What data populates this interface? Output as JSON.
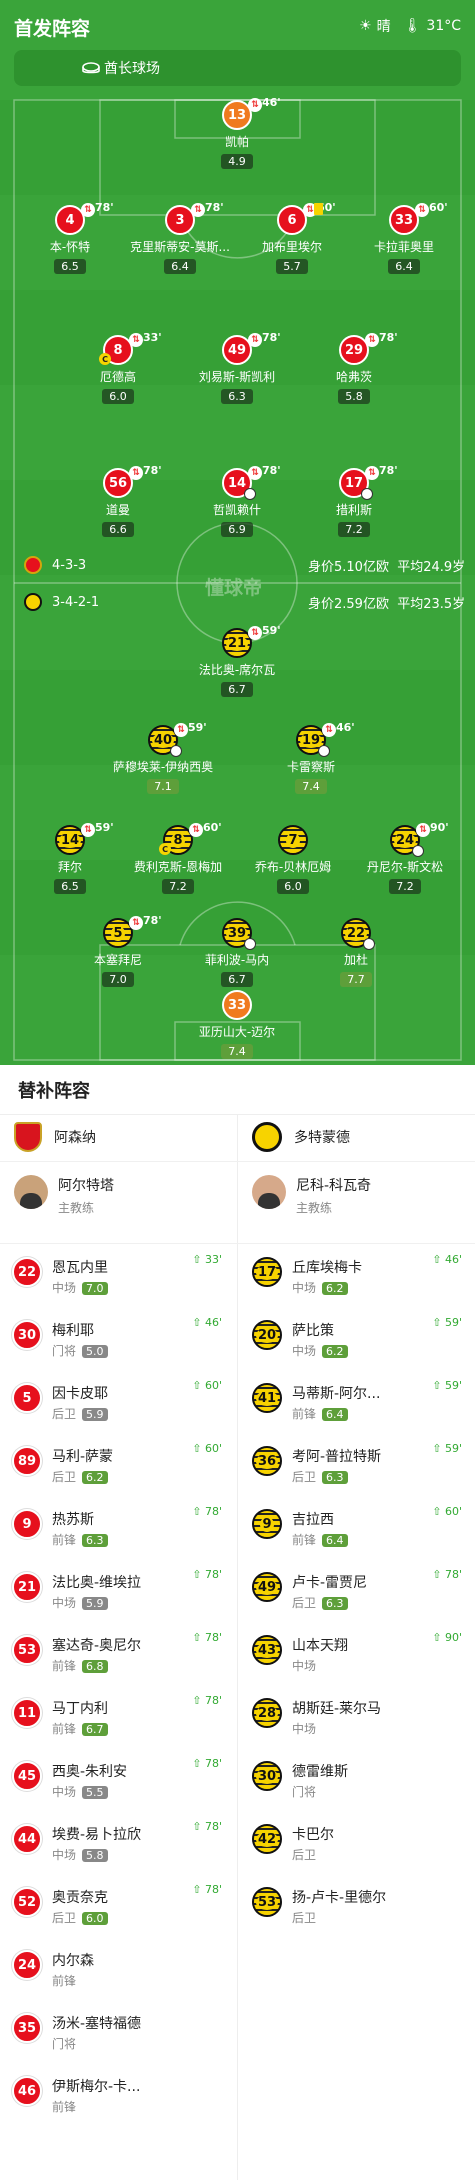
{
  "header": {
    "title": "首发阵容",
    "weather": "晴",
    "temp": "31°C",
    "venue": "酋长球场"
  },
  "watermark": "懂球帝",
  "arsenal": {
    "formation": "4-3-3",
    "value": "身价5.10亿欧",
    "age": "平均24.9岁"
  },
  "dortmund": {
    "formation": "3-4-2-1",
    "value": "身价2.59亿欧",
    "age": "平均23.5岁"
  },
  "starters": [
    {
      "num": "13",
      "name": "凯帕",
      "rate": "4.9",
      "sub": "46'",
      "kit": "gk"
    },
    {
      "num": "4",
      "name": "本-怀特",
      "rate": "6.5",
      "sub": "78'",
      "kit": "red"
    },
    {
      "num": "3",
      "name": "克里斯蒂安-莫斯...",
      "rate": "6.4",
      "sub": "78'",
      "kit": "red"
    },
    {
      "num": "6",
      "name": "加布里埃尔",
      "rate": "5.7",
      "sub": "60'",
      "kit": "red"
    },
    {
      "num": "33",
      "name": "卡拉菲奥里",
      "rate": "6.4",
      "sub": "60'",
      "kit": "red"
    },
    {
      "num": "8",
      "name": "厄德高",
      "rate": "6.0",
      "sub": "33'",
      "kit": "red"
    },
    {
      "num": "49",
      "name": "刘易斯-斯凯利",
      "rate": "6.3",
      "sub": "78'",
      "kit": "red"
    },
    {
      "num": "29",
      "name": "哈弗茨",
      "rate": "5.8",
      "sub": "78'",
      "kit": "red"
    },
    {
      "num": "56",
      "name": "道曼",
      "rate": "6.6",
      "sub": "78'",
      "kit": "red"
    },
    {
      "num": "14",
      "name": "哲凯赖什",
      "rate": "6.9",
      "sub": "78'",
      "kit": "red"
    },
    {
      "num": "17",
      "name": "措利斯",
      "rate": "7.2",
      "sub": "78'",
      "kit": "red"
    },
    {
      "num": "21",
      "name": "法比奥-席尔瓦",
      "rate": "6.7",
      "sub": "59'",
      "kit": "yel"
    },
    {
      "num": "40",
      "name": "萨穆埃莱-伊纳西奥",
      "rate": "7.1",
      "sub": "59'",
      "kit": "yel"
    },
    {
      "num": "19",
      "name": "卡雷察斯",
      "rate": "7.4",
      "sub": "46'",
      "kit": "yel"
    },
    {
      "num": "14",
      "name": "拜尔",
      "rate": "6.5",
      "sub": "59'",
      "kit": "yel"
    },
    {
      "num": "8",
      "name": "费利克斯-恩梅加",
      "rate": "7.2",
      "sub": "60'",
      "kit": "yel"
    },
    {
      "num": "7",
      "name": "乔布-贝林厄姆",
      "rate": "6.0",
      "sub": "",
      "kit": "yel"
    },
    {
      "num": "24",
      "name": "丹尼尔-斯文松",
      "rate": "7.2",
      "sub": "90'",
      "kit": "yel"
    },
    {
      "num": "5",
      "name": "本塞拜尼",
      "rate": "7.0",
      "sub": "78'",
      "kit": "yel"
    },
    {
      "num": "39",
      "name": "菲利波-马内",
      "rate": "6.7",
      "sub": "",
      "kit": "yel"
    },
    {
      "num": "22",
      "name": "加杜",
      "rate": "7.7",
      "sub": "",
      "kit": "yel"
    },
    {
      "num": "33",
      "name": "亚历山大-迈尔",
      "rate": "7.4",
      "sub": "",
      "kit": "gk"
    }
  ],
  "subs": {
    "title": "替补阵容",
    "home_team": "阿森纳",
    "away_team": "多特蒙德",
    "home_coach": {
      "name": "阿尔特塔",
      "role": "主教练"
    },
    "away_coach": {
      "name": "尼科-科瓦奇",
      "role": "主教练"
    },
    "home": [
      {
        "num": "22",
        "name": "恩瓦内里",
        "pos": "中场",
        "rate": "7.0",
        "time": "33'"
      },
      {
        "num": "30",
        "name": "梅利耶",
        "pos": "门将",
        "rate": "5.0",
        "time": "46'"
      },
      {
        "num": "5",
        "name": "因卡皮耶",
        "pos": "后卫",
        "rate": "5.9",
        "time": "60'"
      },
      {
        "num": "89",
        "name": "马利-萨蒙",
        "pos": "后卫",
        "rate": "6.2",
        "time": "60'"
      },
      {
        "num": "9",
        "name": "热苏斯",
        "pos": "前锋",
        "rate": "6.3",
        "time": "78'"
      },
      {
        "num": "21",
        "name": "法比奥-维埃拉",
        "pos": "中场",
        "rate": "5.9",
        "time": "78'"
      },
      {
        "num": "53",
        "name": "塞达奇-奥尼尔",
        "pos": "前锋",
        "rate": "6.8",
        "time": "78'"
      },
      {
        "num": "11",
        "name": "马丁内利",
        "pos": "前锋",
        "rate": "6.7",
        "time": "78'"
      },
      {
        "num": "45",
        "name": "西奥-朱利安",
        "pos": "中场",
        "rate": "5.5",
        "time": "78'"
      },
      {
        "num": "44",
        "name": "埃费-易卜拉欣",
        "pos": "中场",
        "rate": "5.8",
        "time": "78'"
      },
      {
        "num": "52",
        "name": "奥贡奈克",
        "pos": "后卫",
        "rate": "6.0",
        "time": "78'"
      },
      {
        "num": "24",
        "name": "内尔森",
        "pos": "前锋",
        "rate": "",
        "time": ""
      },
      {
        "num": "35",
        "name": "汤米-塞特福德",
        "pos": "门将",
        "rate": "",
        "time": ""
      },
      {
        "num": "46",
        "name": "伊斯梅尔-卡...",
        "pos": "前锋",
        "rate": "",
        "time": ""
      }
    ],
    "away": [
      {
        "num": "17",
        "name": "丘库埃梅卡",
        "pos": "中场",
        "rate": "6.2",
        "time": "46'"
      },
      {
        "num": "20",
        "name": "萨比策",
        "pos": "中场",
        "rate": "6.2",
        "time": "59'"
      },
      {
        "num": "41",
        "name": "马蒂斯-阿尔...",
        "pos": "前锋",
        "rate": "6.4",
        "time": "59'"
      },
      {
        "num": "36",
        "name": "考阿-普拉特斯",
        "pos": "后卫",
        "rate": "6.3",
        "time": "59'"
      },
      {
        "num": "9",
        "name": "吉拉西",
        "pos": "前锋",
        "rate": "6.4",
        "time": "60'"
      },
      {
        "num": "49",
        "name": "卢卡-雷贾尼",
        "pos": "后卫",
        "rate": "6.3",
        "time": "78'"
      },
      {
        "num": "43",
        "name": "山本天翔",
        "pos": "中场",
        "rate": "",
        "time": "90'"
      },
      {
        "num": "28",
        "name": "胡斯廷-莱尔马",
        "pos": "中场",
        "rate": "",
        "time": ""
      },
      {
        "num": "30",
        "name": "德雷维斯",
        "pos": "门将",
        "rate": "",
        "time": ""
      },
      {
        "num": "42",
        "name": "卡巴尔",
        "pos": "后卫",
        "rate": "",
        "time": ""
      },
      {
        "num": "53",
        "name": "扬-卢卡-里德尔",
        "pos": "后卫",
        "rate": "",
        "time": ""
      }
    ]
  }
}
